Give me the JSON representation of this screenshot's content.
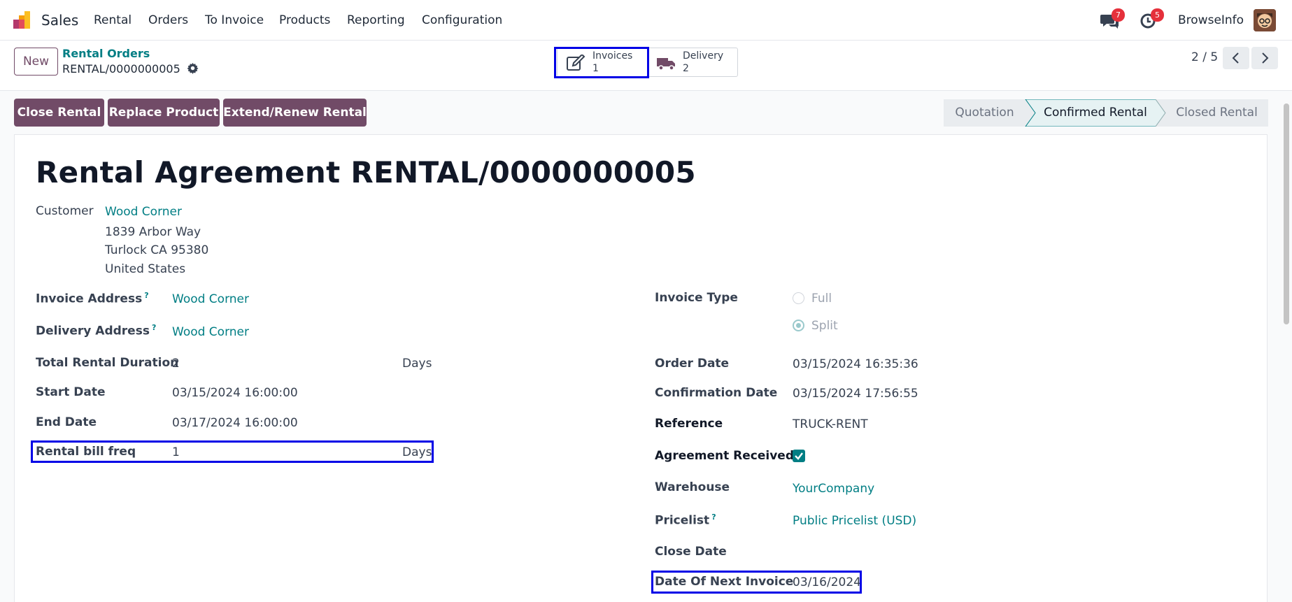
{
  "app": {
    "name": "Sales",
    "menu": [
      "Rental",
      "Orders",
      "To Invoice",
      "Products",
      "Reporting",
      "Configuration"
    ],
    "messages_badge": "7",
    "activities_badge": "5",
    "company": "BrowseInfo"
  },
  "control_panel": {
    "new_label": "New",
    "breadcrumb_parent": "Rental Orders",
    "breadcrumb_current": "RENTAL/0000000005",
    "smart_buttons": [
      {
        "label": "Invoices",
        "count": "1",
        "icon": "edit-icon"
      },
      {
        "label": "Delivery",
        "count": "2",
        "icon": "truck-icon"
      }
    ],
    "pager": "2 / 5"
  },
  "actions": [
    "Close Rental",
    "Replace Product",
    "Extend/Renew Rental"
  ],
  "stages": [
    {
      "label": "Quotation",
      "state": "done"
    },
    {
      "label": "Confirmed Rental",
      "state": "current"
    },
    {
      "label": "Closed Rental",
      "state": "todo"
    }
  ],
  "form": {
    "title": "Rental Agreement RENTAL/0000000005",
    "customer": {
      "label": "Customer",
      "name": "Wood Corner",
      "address": [
        "1839 Arbor Way",
        "Turlock CA 95380",
        "United States"
      ]
    },
    "left": {
      "invoice_address": {
        "label": "Invoice Address",
        "value": "Wood Corner"
      },
      "delivery_address": {
        "label": "Delivery Address",
        "value": "Wood Corner"
      },
      "total_rental_duration": {
        "label": "Total Rental Duration",
        "value": "2",
        "unit": "Days"
      },
      "start_date": {
        "label": "Start Date",
        "value": "03/15/2024 16:00:00"
      },
      "end_date": {
        "label": "End Date",
        "value": "03/17/2024 16:00:00"
      },
      "rental_bill_freq": {
        "label": "Rental bill freq",
        "value": "1",
        "unit": "Days"
      }
    },
    "right": {
      "invoice_type": {
        "label": "Invoice Type",
        "options": [
          "Full",
          "Split"
        ],
        "selected": "Split"
      },
      "order_date": {
        "label": "Order Date",
        "value": "03/15/2024 16:35:36"
      },
      "confirmation_date": {
        "label": "Confirmation Date",
        "value": "03/15/2024 17:56:55"
      },
      "reference": {
        "label": "Reference",
        "value": "TRUCK-RENT"
      },
      "agreement_received": {
        "label": "Agreement Received?",
        "checked": true
      },
      "warehouse": {
        "label": "Warehouse",
        "value": "YourCompany"
      },
      "pricelist": {
        "label": "Pricelist",
        "value": "Public Pricelist (USD)"
      },
      "close_date": {
        "label": "Close Date",
        "value": ""
      },
      "date_next_invoice": {
        "label": "Date Of Next Invoice",
        "value": "03/16/2024"
      }
    },
    "help_marker": "?"
  },
  "colors": {
    "brand": "#714b67",
    "link": "#017e84",
    "highlight": "#0000e6"
  }
}
